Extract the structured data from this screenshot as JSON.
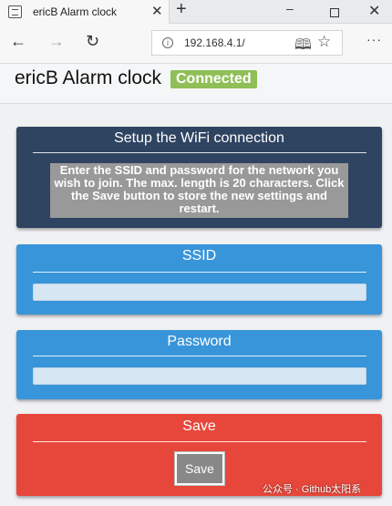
{
  "browser": {
    "tab_title": "ericB Alarm clock",
    "tab_close": "✕",
    "new_tab": "+",
    "url": "192.168.4.1/",
    "more": "···"
  },
  "header": {
    "title": "ericB Alarm clock",
    "status": "Connected",
    "status_color": "#8fbf56"
  },
  "wifi_panel": {
    "title": "Setup the WiFi connection",
    "description": "Enter the SSID and password for the network you wish to join. The max. length is 20 characters. Click the Save button to store the new settings and restart."
  },
  "ssid_panel": {
    "title": "SSID",
    "value": ""
  },
  "password_panel": {
    "title": "Password",
    "value": ""
  },
  "save_panel": {
    "title": "Save",
    "button_label": "Save"
  },
  "watermark": "公众号 · Github太阳系",
  "colors": {
    "wifi_panel": "#2f4461",
    "input_panels": "#3895d9",
    "save_panel": "#e7473b"
  }
}
